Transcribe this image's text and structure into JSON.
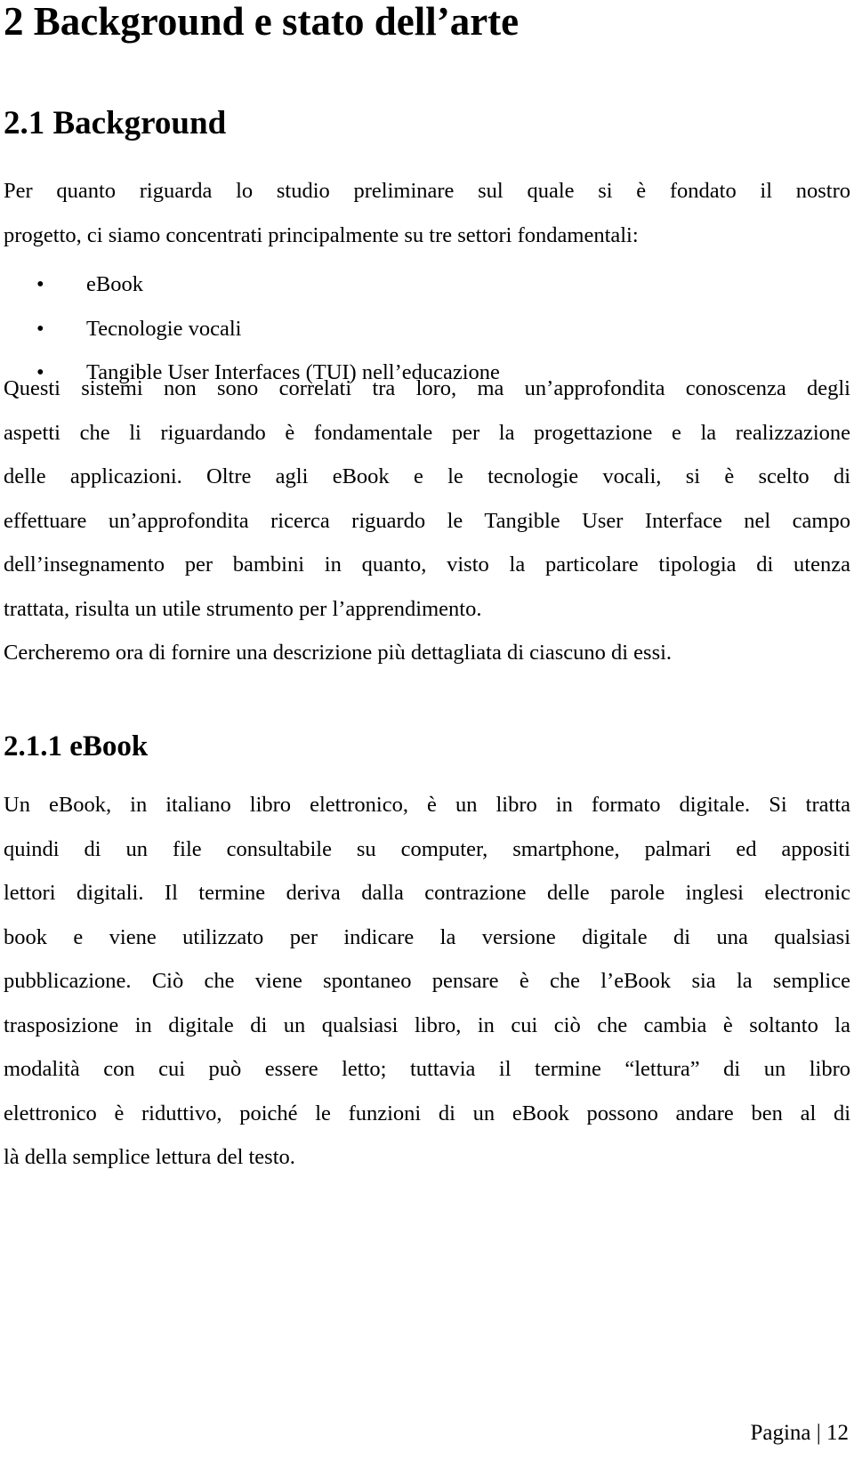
{
  "chapter_title": "2 Background e stato dell’arte",
  "section_title": "2.1 Background",
  "intro_lines": [
    "Per quanto riguarda lo studio preliminare sul quale si è fondato il nostro",
    "progetto, ci siamo concentrati principalmente su tre settori fondamentali:"
  ],
  "bullets": [
    {
      "symbol": "•",
      "text": "eBook"
    },
    {
      "symbol": "•",
      "text": "Tecnologie vocali"
    },
    {
      "symbol": "•",
      "text": "Tangible User Interfaces (TUI) nell’educazione"
    }
  ],
  "body_lines": [
    "Questi sistemi non sono correlati tra loro, ma un’approfondita conoscenza degli",
    "aspetti che li riguardando è fondamentale per la progettazione e la realizzazione",
    "delle applicazioni. Oltre agli eBook e le tecnologie vocali, si è scelto di",
    "effettuare un’approfondita ricerca riguardo le Tangible User Interface nel campo",
    "dell’insegnamento per bambini in quanto, visto la particolare tipologia di utenza",
    "trattata, risulta un utile strumento per l’apprendimento.",
    "Cercheremo ora di fornire una descrizione più dettagliata di ciascuno di essi."
  ],
  "subsection_title": "2.1.1 eBook",
  "ebook_lines": [
    "Un eBook, in italiano libro elettronico, è un libro in formato digitale. Si tratta",
    "quindi di un file consultabile su computer, smartphone, palmari ed appositi",
    "lettori digitali. Il termine deriva dalla contrazione delle parole inglesi electronic",
    "book e viene utilizzato per indicare la versione digitale di una qualsiasi",
    "pubblicazione. Ciò che viene spontaneo pensare è che l’eBook sia la semplice",
    "trasposizione in digitale di un qualsiasi libro, in cui ciò che cambia è soltanto la",
    "modalità con cui può essere letto; tuttavia il termine “lettura” di un libro",
    "elettronico è riduttivo, poiché le funzioni di un eBook possono andare ben al di",
    "là della semplice lettura del testo."
  ],
  "footer": {
    "label": "Pagina | 12"
  }
}
